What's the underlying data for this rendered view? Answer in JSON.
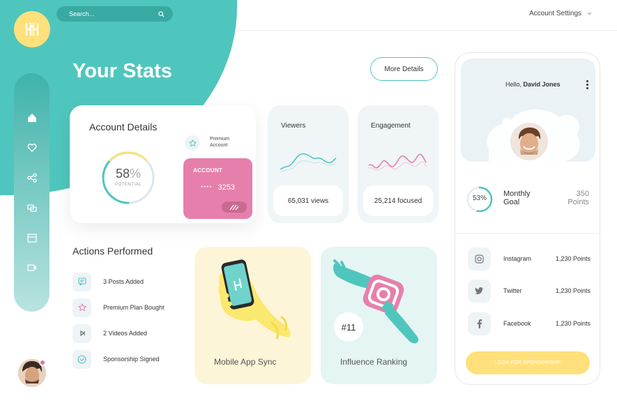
{
  "search": {
    "placeholder": "Search..."
  },
  "header": {
    "account_settings": "Account Settings"
  },
  "page_title": "Your Stats",
  "more_details": "More Details",
  "account_details": {
    "title": "Account Details",
    "potential_value": "58",
    "potential_unit": "%",
    "potential_label": "POTENTIAL",
    "potential_fraction": 0.58,
    "premium_label": "Premium Account",
    "card_label": "ACCOUNT",
    "card_mask": "****",
    "card_number": "3253"
  },
  "stats": {
    "viewers": {
      "title": "Viewers",
      "value": "65,031 views",
      "color": "#4fc6bd"
    },
    "engagement": {
      "title": "Engagement",
      "value": "25,214 focused",
      "color": "#e67fab"
    }
  },
  "actions": {
    "title": "Actions Performed",
    "items": [
      {
        "label": "3 Posts Added",
        "icon": "message-icon"
      },
      {
        "label": "Premium Plan Bought",
        "icon": "star-icon"
      },
      {
        "label": "2 Videos Added",
        "icon": "play-icon"
      },
      {
        "label": "Sponsorship Signed",
        "icon": "check-icon"
      }
    ]
  },
  "promos": {
    "mobile": {
      "title": "Mobile App Sync"
    },
    "influence": {
      "title": "Influence Ranking",
      "rank": "#11"
    }
  },
  "profile": {
    "greeting": "Hello,",
    "name": "David Jones",
    "goal_percent": "53",
    "goal_unit": "%",
    "goal_fraction": 0.53,
    "goal_label_1": "Monthly",
    "goal_label_2": "Goal",
    "goal_points_1": "350",
    "goal_points_2": "Points"
  },
  "social": [
    {
      "name": "Instagram",
      "points": "1,230 Points",
      "icon": "instagram-icon"
    },
    {
      "name": "Twitter",
      "points": "1,230 Points",
      "icon": "twitter-icon"
    },
    {
      "name": "Facebook",
      "points": "1,230 Points",
      "icon": "facebook-icon"
    }
  ],
  "sponsorship_button": "LOOK FOR SPONSORSHIP",
  "colors": {
    "teal": "#4fc6bd",
    "yellow": "#ffe07a",
    "pink": "#e67fab"
  }
}
